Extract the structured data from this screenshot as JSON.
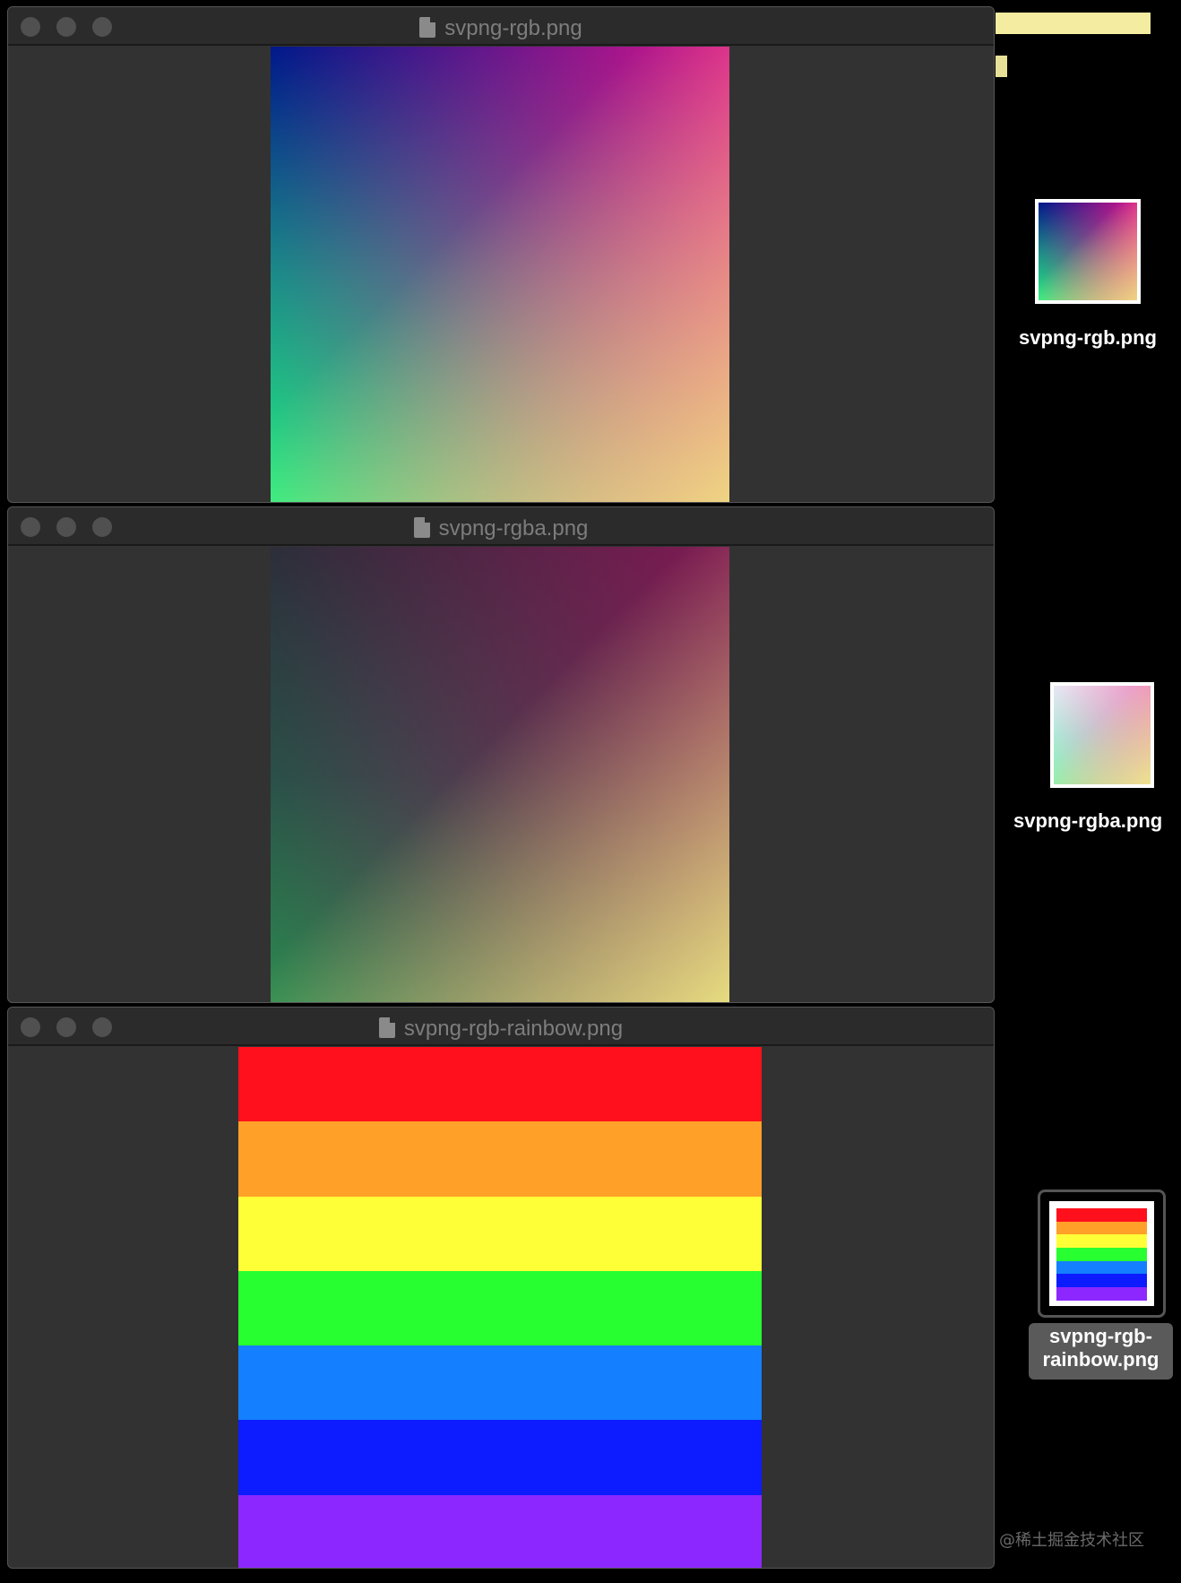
{
  "windows": [
    {
      "title": "svpng-rgb.png"
    },
    {
      "title": "svpng-rgba.png"
    },
    {
      "title": "svpng-rgb-rainbow.png"
    }
  ],
  "rainbow_colors": [
    "#ff101c",
    "#ffa028",
    "#ffff38",
    "#28ff30",
    "#1480ff",
    "#0c1cff",
    "#8c28ff"
  ],
  "desktop": {
    "icons": [
      {
        "label": "svpng-rgb.png"
      },
      {
        "label": "svpng-rgba.png"
      },
      {
        "label_line1": "svpng-rgb-",
        "label_line2": "rainbow.png"
      }
    ],
    "watermark": "@稀土掘金技术社区"
  }
}
